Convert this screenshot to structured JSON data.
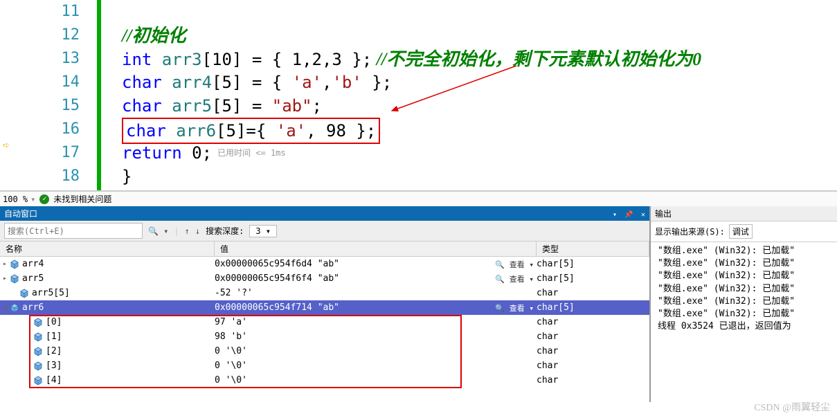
{
  "editor": {
    "lines": [
      "11",
      "12",
      "13",
      "14",
      "15",
      "16",
      "17",
      "18"
    ],
    "ln12_comment": "//初始化",
    "ln13_a": "int ",
    "ln13_b": "arr3",
    "ln13_c": "[10] = { 1,2,3 };",
    "ln13_d": " //不完全初始化，剩下元素默认初始化为0",
    "ln14_a": "char ",
    "ln14_b": "arr4",
    "ln14_c": "[5] = { ",
    "ln14_d": "'a'",
    "ln14_e": ",",
    "ln14_f": "'b'",
    "ln14_g": " };",
    "ln15_a": "char ",
    "ln15_b": "arr5",
    "ln15_c": "[5] = ",
    "ln15_d": "\"ab\"",
    "ln15_e": ";",
    "ln16_a": "char ",
    "ln16_b": "arr6",
    "ln16_c": "[5]={ ",
    "ln16_d": "'a'",
    "ln16_e": ", 98 };",
    "ln17_a": "return ",
    "ln17_b": "0;",
    "ln17_hint": "已用时间 <= 1ms",
    "ln18": "}"
  },
  "status": {
    "zoom": "100 %",
    "msg": "未找到相关问题"
  },
  "autos": {
    "title": "自动窗口",
    "search_ph": "搜索(Ctrl+E)",
    "depth_label": "搜索深度:",
    "depth_val": "3",
    "hdr_name": "名称",
    "hdr_val": "值",
    "hdr_type": "类型",
    "view_label": "查看",
    "rows": [
      {
        "tw": "▸",
        "ind": 0,
        "name": "arr4",
        "val": "0x00000065c954f6d4 \"ab\"",
        "type": "char[5]",
        "view": true
      },
      {
        "tw": "▸",
        "ind": 0,
        "name": "arr5",
        "val": "0x00000065c954f6f4 \"ab\"",
        "type": "char[5]",
        "view": true
      },
      {
        "tw": "",
        "ind": 1,
        "name": "arr5[5]",
        "val": "-52 '?'",
        "type": "char"
      },
      {
        "tw": "◢",
        "ind": 0,
        "name": "arr6",
        "val": "0x00000065c954f714 \"ab\"",
        "type": "char[5]",
        "view": true,
        "sel": true
      },
      {
        "tw": "",
        "ind": 2,
        "name": "[0]",
        "val": "97 'a'",
        "type": "char"
      },
      {
        "tw": "",
        "ind": 2,
        "name": "[1]",
        "val": "98 'b'",
        "type": "char"
      },
      {
        "tw": "",
        "ind": 2,
        "name": "[2]",
        "val": "0 '\\0'",
        "type": "char"
      },
      {
        "tw": "",
        "ind": 2,
        "name": "[3]",
        "val": "0 '\\0'",
        "type": "char"
      },
      {
        "tw": "",
        "ind": 2,
        "name": "[4]",
        "val": "0 '\\0'",
        "type": "char"
      }
    ]
  },
  "output": {
    "title": "输出",
    "src_label": "显示输出来源(S):",
    "src_val": "调试",
    "lines": [
      "\"数组.exe\" (Win32): 已加载\"",
      "\"数组.exe\" (Win32): 已加载\"",
      "\"数组.exe\" (Win32): 已加载\"",
      "\"数组.exe\" (Win32): 已加载\"",
      "\"数组.exe\" (Win32): 已加载\"",
      "\"数组.exe\" (Win32): 已加载\"",
      "线程 0x3524 已退出，返回值为"
    ]
  },
  "watermark": "CSDN @雨翼轻尘"
}
